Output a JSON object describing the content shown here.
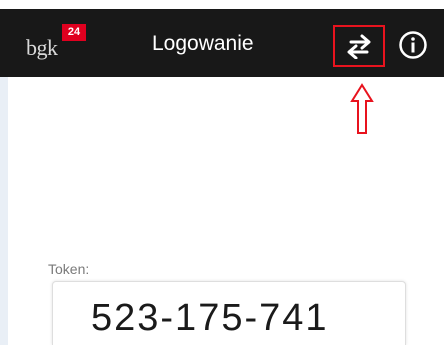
{
  "header": {
    "logo_text": "bgk",
    "logo_badge": "24",
    "title": "Logowanie",
    "switch_icon": "swap-arrows-icon",
    "info_icon": "info-icon"
  },
  "annotation": {
    "icon": "up-arrow-icon",
    "color": "#e8131e"
  },
  "token": {
    "label": "Token:",
    "value": "523-175-741"
  },
  "colors": {
    "topbar": "#181818",
    "badge": "#e0001f",
    "highlight": "#e8131e"
  }
}
